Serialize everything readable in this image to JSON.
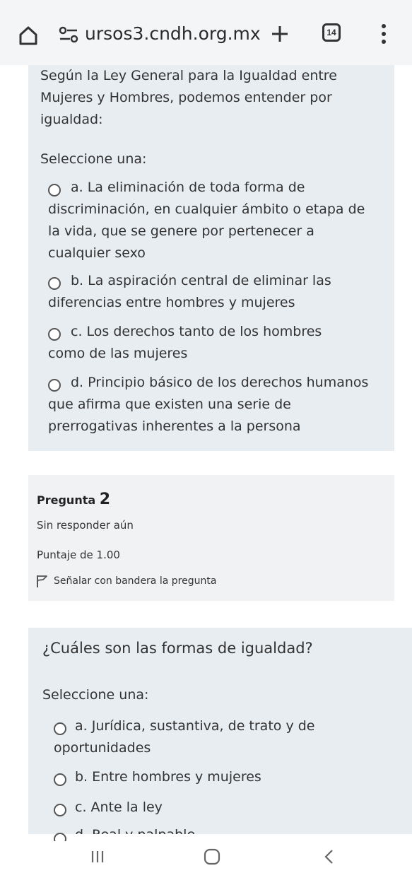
{
  "browser": {
    "url": "ursos3.cndh.org.mx",
    "tab_count": "14",
    "icons": {
      "home": "home-icon",
      "site": "site-settings-icon",
      "new_tab": "plus-icon",
      "menu": "more-vert-icon"
    }
  },
  "question1": {
    "text": "Según la Ley General para la Igualdad entre Mujeres y Hombres, podemos entender por igualdad:",
    "select_label": "Seleccione una:",
    "options": [
      {
        "label": "a. La eliminación de toda forma de discriminación, en cualquier ámbito o etapa de la vida, que se genere por pertenecer a cualquier sexo"
      },
      {
        "label": "b. La aspiración central de eliminar las diferencias entre hombres y mujeres"
      },
      {
        "label": "c. Los derechos tanto de los hombres como de las mujeres"
      },
      {
        "label": "d. Principio básico de los derechos humanos que afirma que existen una serie de prerrogativas inherentes a la persona"
      }
    ]
  },
  "question2_info": {
    "title_prefix": "Pregunta",
    "number": "2",
    "status": "Sin responder aún",
    "score": "Puntaje de 1.00",
    "flag_label": "Señalar con bandera la pregunta"
  },
  "question2": {
    "text": "¿Cuáles son las formas de igualdad?",
    "select_label": "Seleccione una:",
    "options": [
      {
        "label": "a. Jurídica, sustantiva, de trato y de oportunidades"
      },
      {
        "label": "b. Entre hombres y mujeres"
      },
      {
        "label": "c. Ante la ley"
      },
      {
        "label": "d. Real y palpable"
      }
    ]
  },
  "nav": {
    "icons": {
      "recents": "recents-icon",
      "home": "home-circle-icon",
      "back": "back-icon"
    }
  },
  "colors": {
    "card_bg": "#e8edf2",
    "info_bg": "#f1f2f4",
    "text": "#333333"
  }
}
